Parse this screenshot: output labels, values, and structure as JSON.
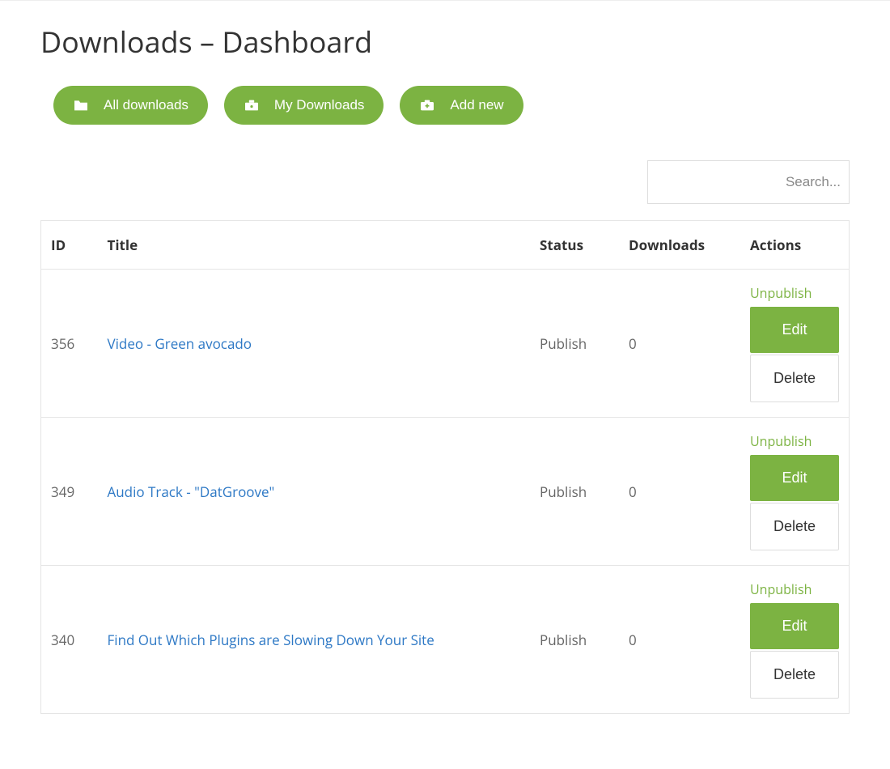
{
  "pageTitle": "Downloads – Dashboard",
  "buttons": {
    "allDownloads": "All downloads",
    "myDownloads": "My Downloads",
    "addNew": "Add new"
  },
  "search": {
    "placeholder": "Search..."
  },
  "columns": {
    "id": "ID",
    "title": "Title",
    "status": "Status",
    "downloads": "Downloads",
    "actions": "Actions"
  },
  "actions": {
    "unpublish": "Unpublish",
    "edit": "Edit",
    "delete": "Delete"
  },
  "rows": [
    {
      "id": "356",
      "title": "Video - Green avocado",
      "status": "Publish",
      "downloads": "0"
    },
    {
      "id": "349",
      "title": "Audio Track - \"DatGroove\"",
      "status": "Publish",
      "downloads": "0"
    },
    {
      "id": "340",
      "title": "Find Out Which Plugins are Slowing Down Your Site",
      "status": "Publish",
      "downloads": "0"
    }
  ],
  "colors": {
    "accent": "#7cb342",
    "link": "#2d78c5"
  }
}
